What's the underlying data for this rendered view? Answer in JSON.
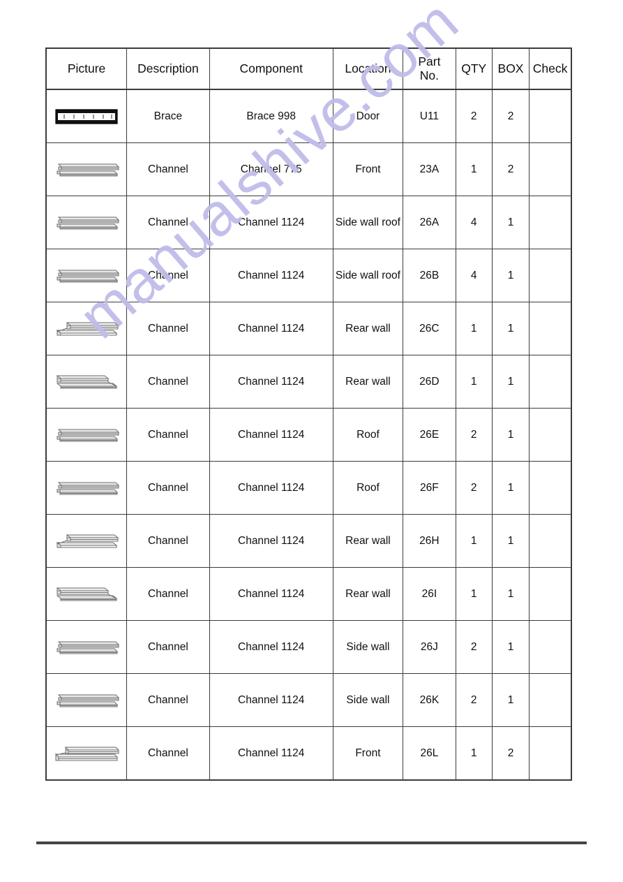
{
  "document": {
    "type": "parts-list-table",
    "watermark": "manualshive.com",
    "watermark_color": "#bfbce9",
    "shaded_row_color": "#e2e2e2",
    "border_color": "#3b3b3b"
  },
  "table": {
    "headers": [
      "Picture",
      "Description",
      "Component",
      "Location",
      "Part\nNo.",
      "QTY",
      "BOX",
      "Check"
    ],
    "header_part_no_line1": "Part",
    "header_part_no_line2": "No.",
    "rows": [
      {
        "picture": "brace-bar",
        "description": "Brace",
        "component": "Brace 998",
        "location": "Door",
        "part_no": "U11",
        "qty": "2",
        "box": "2",
        "check": "",
        "shaded": false
      },
      {
        "picture": "channel-straight",
        "description": "Channel",
        "component": "Channel 775",
        "location": "Front",
        "part_no": "23A",
        "qty": "1",
        "box": "2",
        "check": "",
        "shaded": true
      },
      {
        "picture": "channel-straight",
        "description": "Channel",
        "component": "Channel 1124",
        "location": "Side wall roof",
        "part_no": "26A",
        "qty": "4",
        "box": "1",
        "check": "",
        "shaded": false
      },
      {
        "picture": "channel-straight",
        "description": "Channel",
        "component": "Channel 1124",
        "location": "Side wall roof",
        "part_no": "26B",
        "qty": "4",
        "box": "1",
        "check": "",
        "shaded": true
      },
      {
        "picture": "channel-taper-left",
        "description": "Channel",
        "component": "Channel 1124",
        "location": "Rear wall",
        "part_no": "26C",
        "qty": "1",
        "box": "1",
        "check": "",
        "shaded": false
      },
      {
        "picture": "channel-taper-right",
        "description": "Channel",
        "component": "Channel 1124",
        "location": "Rear wall",
        "part_no": "26D",
        "qty": "1",
        "box": "1",
        "check": "",
        "shaded": true
      },
      {
        "picture": "channel-straight",
        "description": "Channel",
        "component": "Channel 1124",
        "location": "Roof",
        "part_no": "26E",
        "qty": "2",
        "box": "1",
        "check": "",
        "shaded": false
      },
      {
        "picture": "channel-straight",
        "description": "Channel",
        "component": "Channel 1124",
        "location": "Roof",
        "part_no": "26F",
        "qty": "2",
        "box": "1",
        "check": "",
        "shaded": true
      },
      {
        "picture": "channel-taper-left",
        "description": "Channel",
        "component": "Channel 1124",
        "location": "Rear wall",
        "part_no": "26H",
        "qty": "1",
        "box": "1",
        "check": "",
        "shaded": false
      },
      {
        "picture": "channel-taper-right",
        "description": "Channel",
        "component": "Channel 1124",
        "location": "Rear wall",
        "part_no": "26I",
        "qty": "1",
        "box": "1",
        "check": "",
        "shaded": true
      },
      {
        "picture": "channel-straight",
        "description": "Channel",
        "component": "Channel 1124",
        "location": "Side wall",
        "part_no": "26J",
        "qty": "2",
        "box": "1",
        "check": "",
        "shaded": false
      },
      {
        "picture": "channel-straight",
        "description": "Channel",
        "component": "Channel 1124",
        "location": "Side wall",
        "part_no": "26K",
        "qty": "2",
        "box": "1",
        "check": "",
        "shaded": true
      },
      {
        "picture": "channel-taper-left-flat",
        "description": "Channel",
        "component": "Channel 1124",
        "location": "Front",
        "part_no": "26L",
        "qty": "1",
        "box": "2",
        "check": "",
        "shaded": false
      }
    ]
  }
}
